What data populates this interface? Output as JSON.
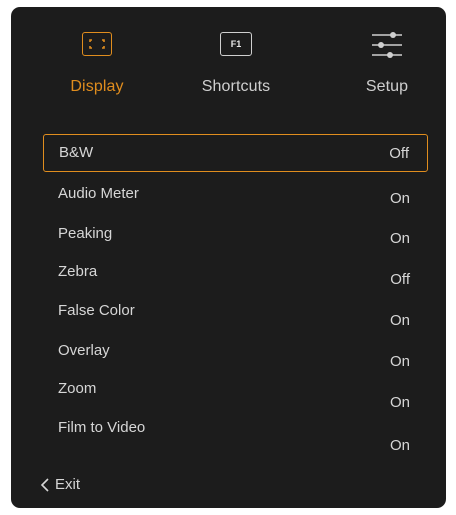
{
  "tabs": [
    {
      "label": "Display",
      "icon": "display-frame-icon"
    },
    {
      "label": "Shortcuts",
      "icon": "f1-key-icon",
      "icon_text": "F1"
    },
    {
      "label": "Setup",
      "icon": "sliders-icon"
    }
  ],
  "accent_color": "#e08d1e",
  "settings": [
    {
      "name": "B&W",
      "value": "Off"
    },
    {
      "name": "Audio Meter",
      "value": "On"
    },
    {
      "name": "Peaking",
      "value": "On"
    },
    {
      "name": "Zebra",
      "value": "Off"
    },
    {
      "name": "False Color",
      "value": "On"
    },
    {
      "name": "Overlay",
      "value": "On"
    },
    {
      "name": "Zoom",
      "value": "On"
    },
    {
      "name": "Film to Video",
      "value": "On"
    }
  ],
  "footer": {
    "exit_label": "Exit",
    "exit_icon": "chevron-left-icon"
  }
}
